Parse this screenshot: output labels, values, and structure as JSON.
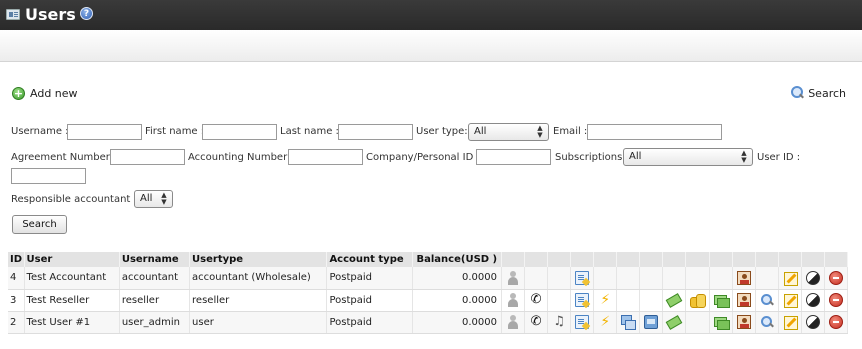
{
  "header": {
    "title": "Users",
    "icon": "users-card-icon",
    "help_icon": "help-icon",
    "help_glyph": "?"
  },
  "toolbar": {
    "add_new_label": "Add new",
    "add_new_glyph": "+",
    "search_label": "Search"
  },
  "filters": {
    "username_label": "Username :",
    "first_name_label": "First name :",
    "last_name_label": "Last name :",
    "user_type_label": "User type:",
    "user_type_value": "All",
    "email_label": "Email :",
    "agreement_number_label": "Agreement Number :",
    "accounting_number_label": "Accounting Number :",
    "company_id_label": "Company/Personal ID :",
    "subscriptions_label": "Subscriptions:",
    "subscriptions_value": "All",
    "user_id_label": "User ID :",
    "responsible_accountant_label": "Responsible accountant :",
    "responsible_accountant_value": "All",
    "search_button": "Search"
  },
  "table": {
    "columns": [
      "ID",
      "User",
      "Username",
      "Usertype",
      "Account type",
      "Balance(USD )"
    ],
    "rows": [
      {
        "id": "4",
        "user": "Test Accountant",
        "username": "accountant",
        "usertype": "accountant (Wholesale)",
        "account_type": "Postpaid",
        "balance": "0.0000",
        "icons": [
          "person-icon",
          "",
          "",
          "card-edit-icon",
          "",
          "",
          "",
          "",
          "",
          "",
          "contact-card-icon",
          "",
          "edit-icon",
          "contrast-icon",
          "delete-icon"
        ]
      },
      {
        "id": "3",
        "user": "Test Reseller",
        "username": "reseller",
        "usertype": "reseller",
        "account_type": "Postpaid",
        "balance": "0.0000",
        "icons": [
          "person-icon",
          "phone-icon",
          "",
          "card-edit-icon",
          "lightning-icon",
          "",
          "",
          "money-icon",
          "coins-icon",
          "cash-icon",
          "contact-card-icon",
          "zoom-icon",
          "edit-icon",
          "contrast-icon",
          "delete-icon"
        ]
      },
      {
        "id": "2",
        "user": "Test User #1",
        "username": "user_admin",
        "usertype": "user",
        "account_type": "Postpaid",
        "balance": "0.0000",
        "icons": [
          "person-icon",
          "phone-icon",
          "music-note-icon",
          "card-edit-icon",
          "lightning-icon",
          "windows-icon",
          "device-icon",
          "money-icon",
          "",
          "cash-icon",
          "contact-card-icon",
          "zoom-icon",
          "edit-icon",
          "contrast-icon",
          "delete-icon"
        ]
      }
    ]
  }
}
